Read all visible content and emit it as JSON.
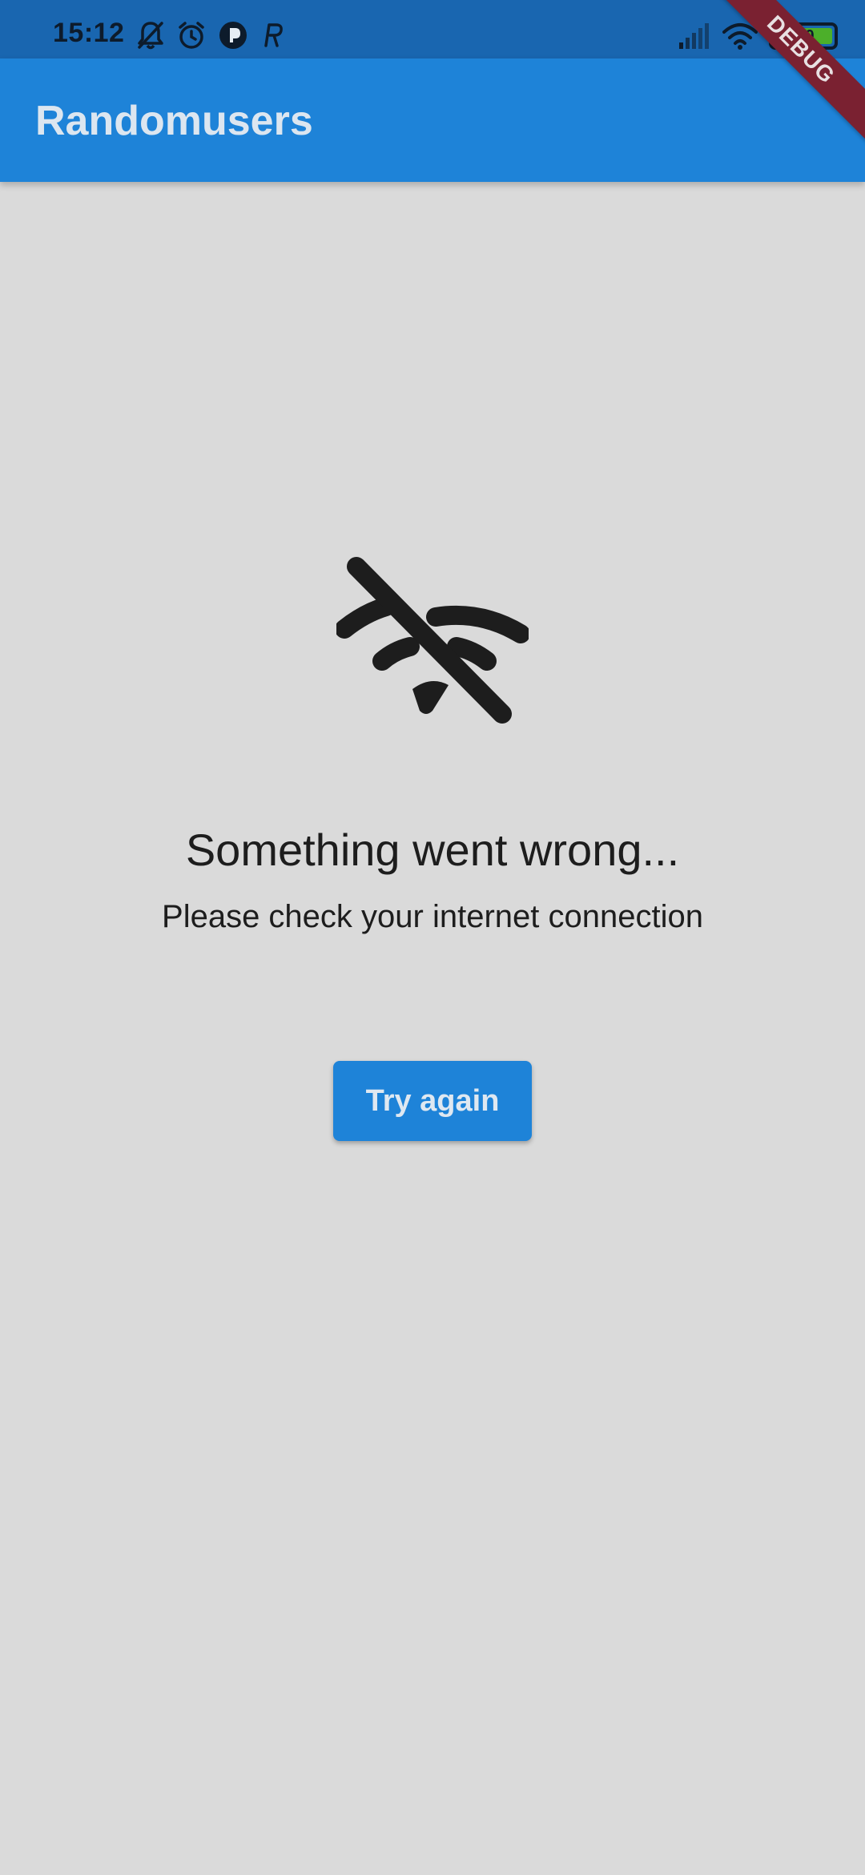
{
  "status_bar": {
    "time": "15:12",
    "battery_level": "100",
    "left_icons": [
      "bell-off-icon",
      "alarm-icon",
      "app-notification-icon",
      "r-notification-icon"
    ],
    "right_icons": [
      "signal-icon",
      "wifi-icon",
      "battery-icon",
      "charging-icon"
    ]
  },
  "app_bar": {
    "title": "Randomusers"
  },
  "debug_banner": {
    "label": "DEBUG"
  },
  "error_state": {
    "icon": "wifi-off-icon",
    "title": "Something went wrong...",
    "message": "Please check your internet connection",
    "retry_label": "Try again"
  },
  "colors": {
    "status_bar": "#1966b0",
    "app_bar": "#1e83d8",
    "background": "#dadada",
    "debug_banner": "#7a2131",
    "text_dark": "#1d1d1d"
  }
}
